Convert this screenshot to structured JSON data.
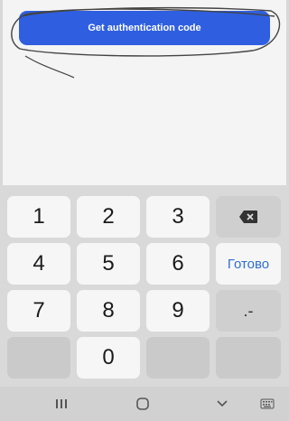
{
  "auth": {
    "button_label": "Get authentication code"
  },
  "keyboard": {
    "keys": [
      "1",
      "2",
      "3",
      "4",
      "5",
      "6",
      "7",
      "8",
      "9",
      "0"
    ],
    "done_label": "Готово",
    "punct_label": ".-"
  },
  "navbar": {
    "recents": "|||",
    "home": "○",
    "back": "⌵",
    "keyboard": "⌨"
  },
  "colors": {
    "accent": "#2f5fe0",
    "done_text": "#2f6fd0",
    "keyboard_bg": "#d9d9d9"
  },
  "icons": [
    "backspace-icon",
    "recents-icon",
    "home-icon",
    "back-icon",
    "keyboard-icon"
  ]
}
